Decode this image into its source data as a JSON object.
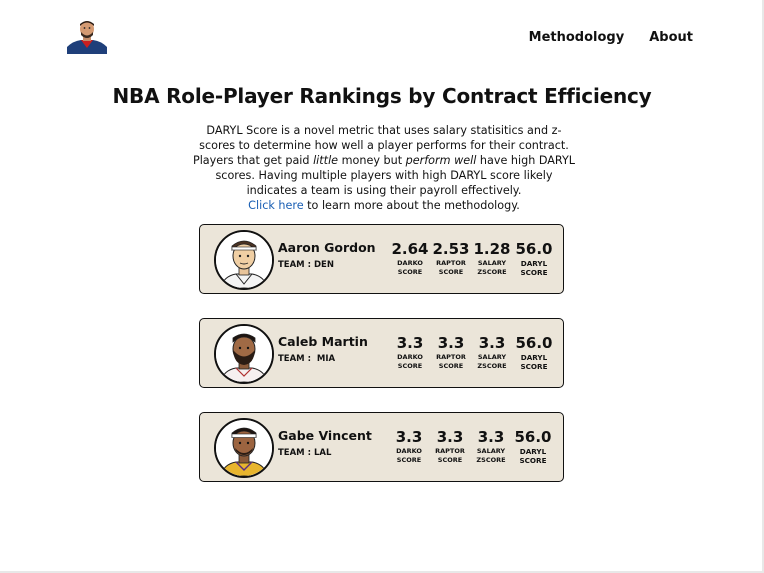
{
  "nav": {
    "items": [
      "Methodology",
      "About"
    ]
  },
  "title": "NBA Role-Player Rankings by Contract Efficiency",
  "intro": {
    "p1": "DARYL Score is a novel metric that uses salary statisitics and z-scores to determine how well a player performs for their contract. Players that get paid ",
    "em1": "little",
    "p2": " money but ",
    "em2": "perform well",
    "p3": " have high DARYL scores. Having multiple players with high DARYL score likely indicates a team is using their payroll effectively.",
    "link": "Click here",
    "p4": " to learn more about the methodology."
  },
  "players": [
    {
      "name": "Aaron Gordon",
      "team_label": "TEAM : DEN",
      "darko": "2.64",
      "raptor": "2.53",
      "salary": "1.28",
      "daryl": "56.0"
    },
    {
      "name": "Caleb Martin",
      "team_label": "TEAM :  MIA",
      "darko": "3.3",
      "raptor": "3.3",
      "salary": "3.3",
      "daryl": "56.0"
    },
    {
      "name": "Gabe Vincent",
      "team_label": "TEAM : LAL",
      "darko": "3.3",
      "raptor": "3.3",
      "salary": "3.3",
      "daryl": "56.0"
    }
  ],
  "labels": {
    "darko": "DARKO SCORE",
    "raptor": "RAPTOR SCORE",
    "salary": "SALARY ZSCORE",
    "daryl": "DARYL SCORE"
  },
  "colors": {
    "card_bg": "#ebe5d9",
    "link": "#1a5fb4"
  }
}
